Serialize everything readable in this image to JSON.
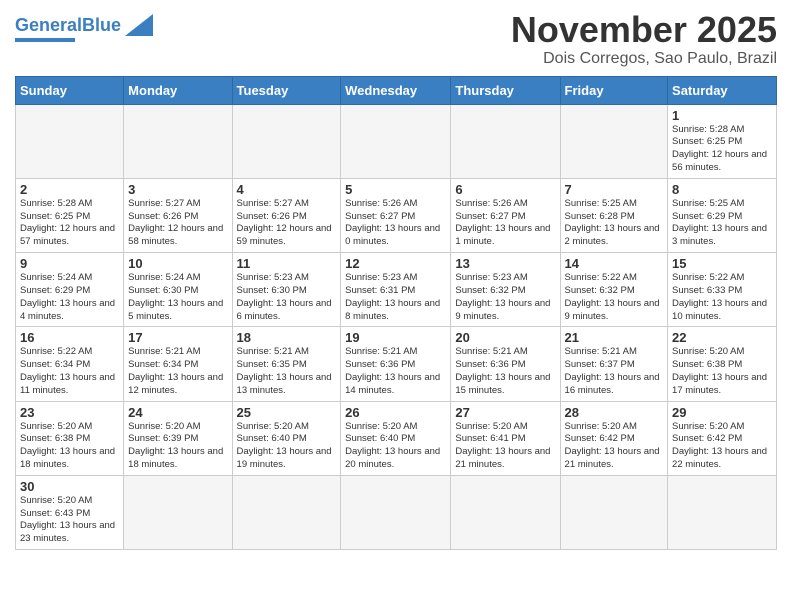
{
  "header": {
    "logo_general": "General",
    "logo_blue": "Blue",
    "month_title": "November 2025",
    "location": "Dois Corregos, Sao Paulo, Brazil"
  },
  "weekdays": [
    "Sunday",
    "Monday",
    "Tuesday",
    "Wednesday",
    "Thursday",
    "Friday",
    "Saturday"
  ],
  "weeks": [
    [
      {
        "day": "",
        "info": ""
      },
      {
        "day": "",
        "info": ""
      },
      {
        "day": "",
        "info": ""
      },
      {
        "day": "",
        "info": ""
      },
      {
        "day": "",
        "info": ""
      },
      {
        "day": "",
        "info": ""
      },
      {
        "day": "1",
        "info": "Sunrise: 5:28 AM\nSunset: 6:25 PM\nDaylight: 12 hours\nand 56 minutes."
      }
    ],
    [
      {
        "day": "2",
        "info": "Sunrise: 5:28 AM\nSunset: 6:25 PM\nDaylight: 12 hours\nand 57 minutes."
      },
      {
        "day": "3",
        "info": "Sunrise: 5:27 AM\nSunset: 6:26 PM\nDaylight: 12 hours\nand 58 minutes."
      },
      {
        "day": "4",
        "info": "Sunrise: 5:27 AM\nSunset: 6:26 PM\nDaylight: 12 hours\nand 59 minutes."
      },
      {
        "day": "5",
        "info": "Sunrise: 5:26 AM\nSunset: 6:27 PM\nDaylight: 13 hours\nand 0 minutes."
      },
      {
        "day": "6",
        "info": "Sunrise: 5:26 AM\nSunset: 6:27 PM\nDaylight: 13 hours\nand 1 minute."
      },
      {
        "day": "7",
        "info": "Sunrise: 5:25 AM\nSunset: 6:28 PM\nDaylight: 13 hours\nand 2 minutes."
      },
      {
        "day": "8",
        "info": "Sunrise: 5:25 AM\nSunset: 6:29 PM\nDaylight: 13 hours\nand 3 minutes."
      }
    ],
    [
      {
        "day": "9",
        "info": "Sunrise: 5:24 AM\nSunset: 6:29 PM\nDaylight: 13 hours\nand 4 minutes."
      },
      {
        "day": "10",
        "info": "Sunrise: 5:24 AM\nSunset: 6:30 PM\nDaylight: 13 hours\nand 5 minutes."
      },
      {
        "day": "11",
        "info": "Sunrise: 5:23 AM\nSunset: 6:30 PM\nDaylight: 13 hours\nand 6 minutes."
      },
      {
        "day": "12",
        "info": "Sunrise: 5:23 AM\nSunset: 6:31 PM\nDaylight: 13 hours\nand 8 minutes."
      },
      {
        "day": "13",
        "info": "Sunrise: 5:23 AM\nSunset: 6:32 PM\nDaylight: 13 hours\nand 9 minutes."
      },
      {
        "day": "14",
        "info": "Sunrise: 5:22 AM\nSunset: 6:32 PM\nDaylight: 13 hours\nand 9 minutes."
      },
      {
        "day": "15",
        "info": "Sunrise: 5:22 AM\nSunset: 6:33 PM\nDaylight: 13 hours\nand 10 minutes."
      }
    ],
    [
      {
        "day": "16",
        "info": "Sunrise: 5:22 AM\nSunset: 6:34 PM\nDaylight: 13 hours\nand 11 minutes."
      },
      {
        "day": "17",
        "info": "Sunrise: 5:21 AM\nSunset: 6:34 PM\nDaylight: 13 hours\nand 12 minutes."
      },
      {
        "day": "18",
        "info": "Sunrise: 5:21 AM\nSunset: 6:35 PM\nDaylight: 13 hours\nand 13 minutes."
      },
      {
        "day": "19",
        "info": "Sunrise: 5:21 AM\nSunset: 6:36 PM\nDaylight: 13 hours\nand 14 minutes."
      },
      {
        "day": "20",
        "info": "Sunrise: 5:21 AM\nSunset: 6:36 PM\nDaylight: 13 hours\nand 15 minutes."
      },
      {
        "day": "21",
        "info": "Sunrise: 5:21 AM\nSunset: 6:37 PM\nDaylight: 13 hours\nand 16 minutes."
      },
      {
        "day": "22",
        "info": "Sunrise: 5:20 AM\nSunset: 6:38 PM\nDaylight: 13 hours\nand 17 minutes."
      }
    ],
    [
      {
        "day": "23",
        "info": "Sunrise: 5:20 AM\nSunset: 6:38 PM\nDaylight: 13 hours\nand 18 minutes."
      },
      {
        "day": "24",
        "info": "Sunrise: 5:20 AM\nSunset: 6:39 PM\nDaylight: 13 hours\nand 18 minutes."
      },
      {
        "day": "25",
        "info": "Sunrise: 5:20 AM\nSunset: 6:40 PM\nDaylight: 13 hours\nand 19 minutes."
      },
      {
        "day": "26",
        "info": "Sunrise: 5:20 AM\nSunset: 6:40 PM\nDaylight: 13 hours\nand 20 minutes."
      },
      {
        "day": "27",
        "info": "Sunrise: 5:20 AM\nSunset: 6:41 PM\nDaylight: 13 hours\nand 21 minutes."
      },
      {
        "day": "28",
        "info": "Sunrise: 5:20 AM\nSunset: 6:42 PM\nDaylight: 13 hours\nand 21 minutes."
      },
      {
        "day": "29",
        "info": "Sunrise: 5:20 AM\nSunset: 6:42 PM\nDaylight: 13 hours\nand 22 minutes."
      }
    ],
    [
      {
        "day": "30",
        "info": "Sunrise: 5:20 AM\nSunset: 6:43 PM\nDaylight: 13 hours\nand 23 minutes."
      },
      {
        "day": "",
        "info": ""
      },
      {
        "day": "",
        "info": ""
      },
      {
        "day": "",
        "info": ""
      },
      {
        "day": "",
        "info": ""
      },
      {
        "day": "",
        "info": ""
      },
      {
        "day": "",
        "info": ""
      }
    ]
  ]
}
